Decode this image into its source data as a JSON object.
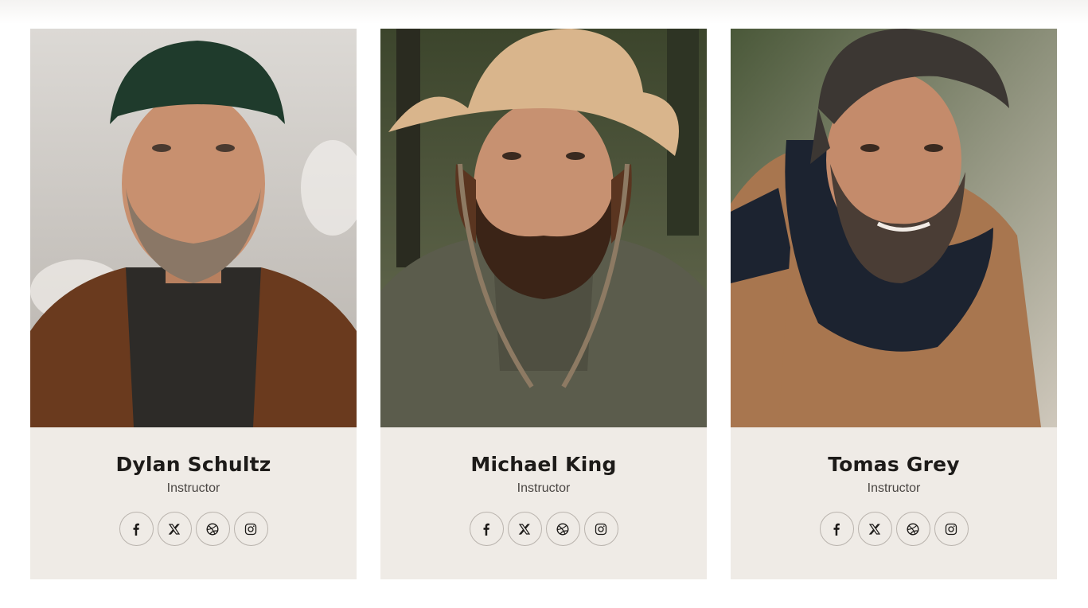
{
  "team": [
    {
      "name": "Dylan Schultz",
      "role": "Instructor",
      "photo": {
        "bg_top": "#d9d6d2",
        "bg_bottom": "#b9b4ae",
        "jacket": "#6a3a1e",
        "shirt": "#2d2b28",
        "skin": "#c8906f",
        "hat": "#1f3b2c",
        "hair": "#5a4334",
        "beard": "#8a7766"
      }
    },
    {
      "name": "Michael King",
      "role": "Instructor",
      "photo": {
        "bg_top": "#3f4a2e",
        "bg_bottom": "#6d7355",
        "jacket": "#5b5c4c",
        "shirt": "#4f4f41",
        "skin": "#c79171",
        "hat": "#d9b58c",
        "hair": "#5a3520",
        "beard": "#3b2417"
      }
    },
    {
      "name": "Tomas Grey",
      "role": "Instructor",
      "photo": {
        "bg_top": "#4d5a3c",
        "bg_bottom": "#c9c3b8",
        "jacket": "#a8764f",
        "shirt": "#1c2330",
        "skin": "#c48b6b",
        "hat": "#3c3733",
        "hair": "#3c3733",
        "beard": "#4a3d35"
      }
    }
  ],
  "social_icons": [
    "facebook-icon",
    "x-icon",
    "dribbble-icon",
    "instagram-icon"
  ],
  "colors": {
    "card_bg": "#efebe6",
    "icon_border": "#b9b3ad",
    "icon_color": "#1d1b19",
    "name_color": "#1d1b19",
    "role_color": "#4a4643"
  }
}
